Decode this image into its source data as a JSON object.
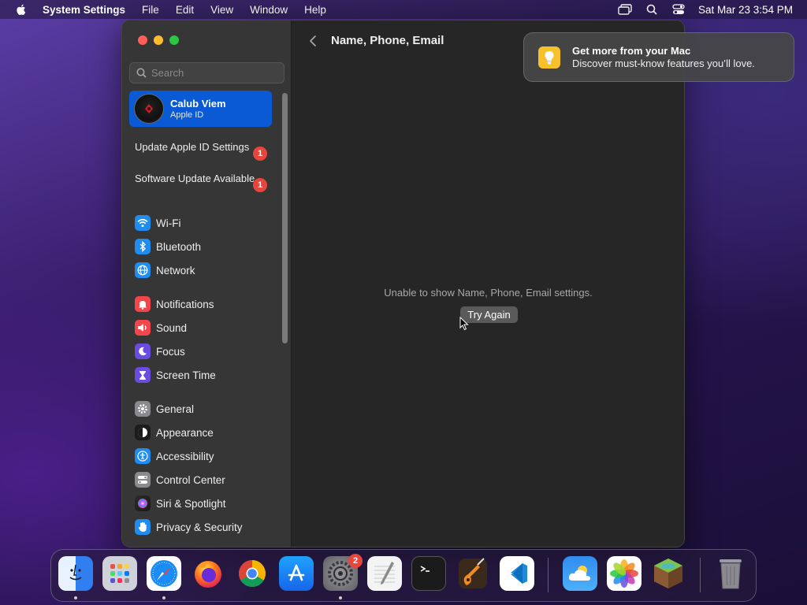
{
  "menubar": {
    "app_name": "System Settings",
    "menus": [
      "File",
      "Edit",
      "View",
      "Window",
      "Help"
    ],
    "datetime": "Sat Mar 23  3:54 PM"
  },
  "search": {
    "placeholder": "Search"
  },
  "account": {
    "name": "Calub Viem",
    "subtitle": "Apple ID"
  },
  "alerts": [
    {
      "label": "Update Apple ID Settings",
      "badge": "1"
    },
    {
      "label": "Software Update Available",
      "badge": "1"
    }
  ],
  "sidebar": {
    "groups": [
      [
        {
          "label": "Wi-Fi",
          "icon": "wifi-icon",
          "color": "#1f8cf0"
        },
        {
          "label": "Bluetooth",
          "icon": "bluetooth-icon",
          "color": "#1f8cf0"
        },
        {
          "label": "Network",
          "icon": "globe-icon",
          "color": "#1f8cf0"
        }
      ],
      [
        {
          "label": "Notifications",
          "icon": "bell-icon",
          "color": "#f2464a"
        },
        {
          "label": "Sound",
          "icon": "speaker-icon",
          "color": "#f2464a"
        },
        {
          "label": "Focus",
          "icon": "moon-icon",
          "color": "#6a4de0"
        },
        {
          "label": "Screen Time",
          "icon": "hourglass-icon",
          "color": "#6a4de0"
        }
      ],
      [
        {
          "label": "General",
          "icon": "gear-icon",
          "color": "#8a8a8e"
        },
        {
          "label": "Appearance",
          "icon": "appearance-icon",
          "color": "#1c1c1c"
        },
        {
          "label": "Accessibility",
          "icon": "accessibility-icon",
          "color": "#1f8cf0"
        },
        {
          "label": "Control Center",
          "icon": "control-center-icon",
          "color": "#8a8a8e"
        },
        {
          "label": "Siri & Spotlight",
          "icon": "siri-icon",
          "color": "#b24de0"
        },
        {
          "label": "Privacy & Security",
          "icon": "hand-icon",
          "color": "#1f8cf0"
        }
      ]
    ]
  },
  "content": {
    "title": "Name, Phone, Email",
    "error_message": "Unable to show Name, Phone, Email settings.",
    "try_again_label": "Try Again"
  },
  "notification": {
    "title": "Get more from your Mac",
    "body": "Discover must-know features you’ll love."
  },
  "dock": {
    "apps": [
      "Finder",
      "Launchpad",
      "Safari",
      "Firefox",
      "Chrome",
      "App Store",
      "System Settings",
      "TextEdit",
      "Terminal",
      "GarageBand",
      "Visual Studio Code",
      "Weather",
      "Photos",
      "Minecraft",
      "Trash"
    ],
    "system_settings_badge": "2"
  }
}
